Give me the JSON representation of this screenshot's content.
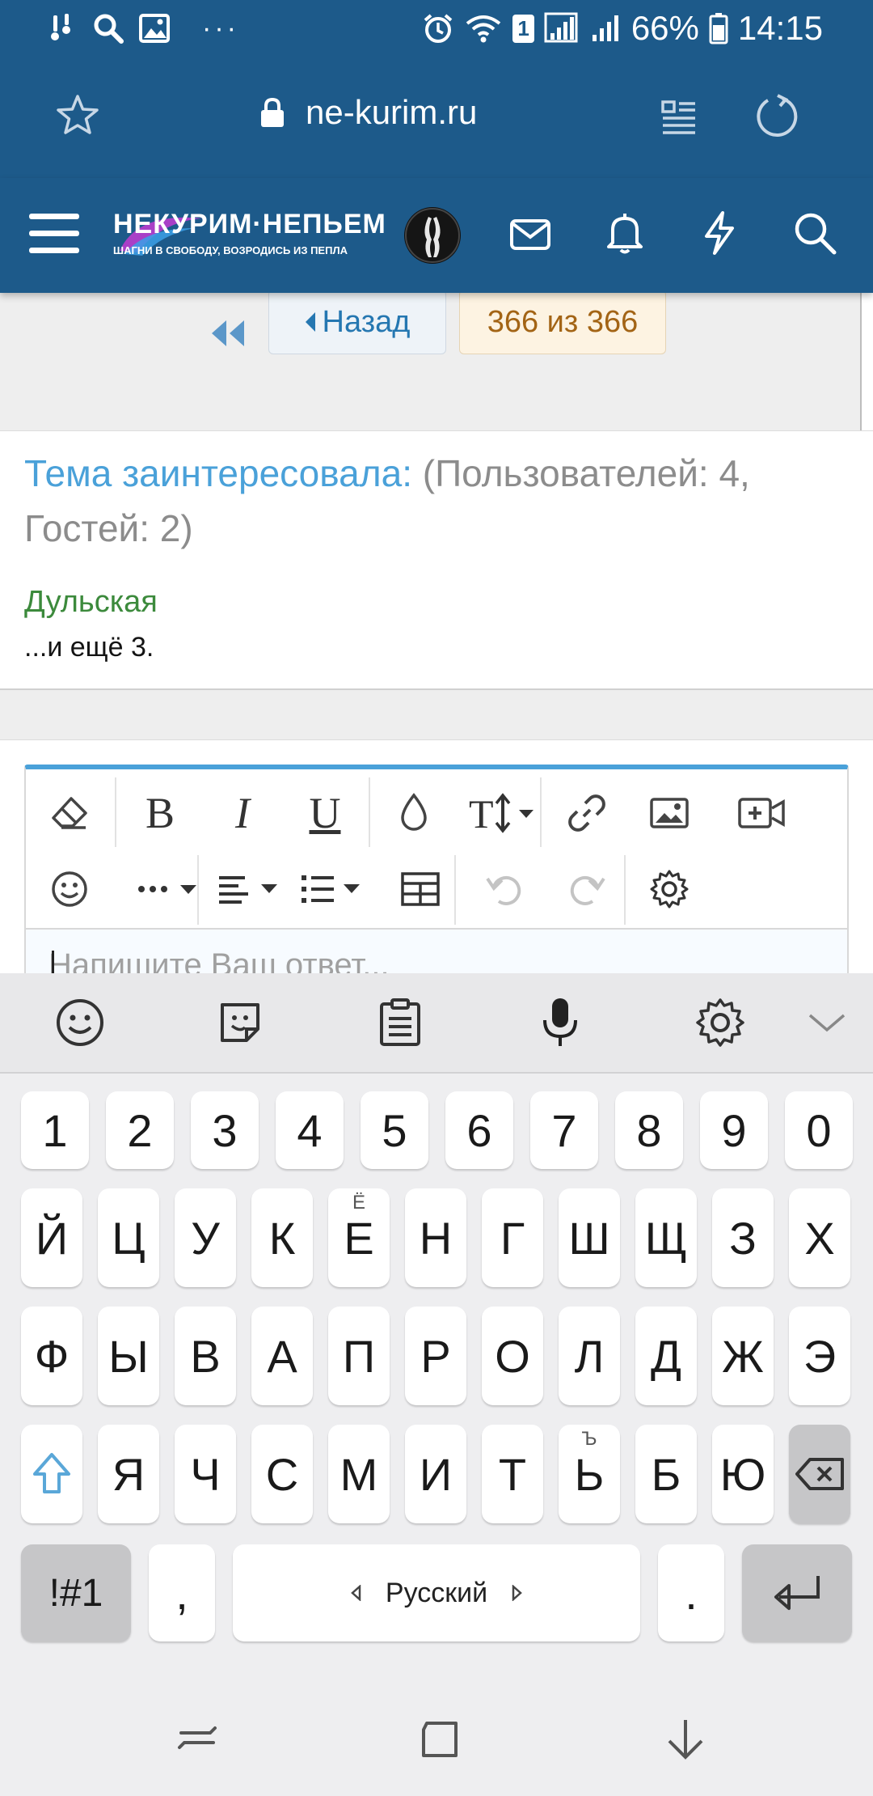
{
  "status_bar": {
    "battery": "66%",
    "time": "14:15",
    "sim_badge": "1",
    "icons": [
      "hand-icon",
      "search-icon",
      "image-icon",
      "more-icon",
      "alarm-icon",
      "wifi-icon",
      "signal-icon",
      "signal2-icon",
      "battery-icon"
    ]
  },
  "browser": {
    "url": "ne-kurim.ru",
    "icons": [
      "star-icon",
      "lock-icon",
      "reader-icon",
      "reload-icon"
    ]
  },
  "site_header": {
    "logo_text": "НЕКУРИМ·НЕПЬЕМ",
    "logo_tagline": "ШАГНИ В СВОБОДУ, ВОЗРОДИСЬ ИЗ ПЕПЛА",
    "icons": [
      "menu-icon",
      "mail-icon",
      "bell-icon",
      "bolt-icon",
      "search-icon"
    ]
  },
  "pager": {
    "back_label": "Назад",
    "count_label": "366 из 366"
  },
  "watchers": {
    "label": "Тема заинтересовала:",
    "counts": "(Пользователей: 4, Гостей: 2)",
    "user": "Дульская",
    "more": "...и ещё 3."
  },
  "editor": {
    "placeholder": "Напишите Ваш ответ...",
    "toolbar_row1": [
      "eraser-icon",
      "bold-icon",
      "italic-icon",
      "underline-icon",
      "color-icon",
      "text-size-icon",
      "link-icon",
      "image-icon",
      "video-icon"
    ],
    "toolbar_row2": [
      "smiley-icon",
      "more-icon",
      "align-icon",
      "list-icon",
      "table-icon",
      "undo-icon",
      "redo-icon",
      "settings-icon"
    ],
    "accent": "#4aa1d9"
  },
  "keyboard": {
    "toolbar": [
      "emoji-icon",
      "sticker-icon",
      "clipboard-icon",
      "mic-icon",
      "settings-icon",
      "collapse-icon"
    ],
    "row_numbers": [
      "1",
      "2",
      "3",
      "4",
      "5",
      "6",
      "7",
      "8",
      "9",
      "0"
    ],
    "row1": [
      "Й",
      "Ц",
      "У",
      "К",
      "Е",
      "Н",
      "Г",
      "Ш",
      "Щ",
      "З",
      "Х"
    ],
    "row1_hint": "Ё",
    "row2": [
      "Ф",
      "Ы",
      "В",
      "А",
      "П",
      "Р",
      "О",
      "Л",
      "Д",
      "Ж",
      "Э"
    ],
    "row3": [
      "Я",
      "Ч",
      "С",
      "М",
      "И",
      "Т",
      "Ь",
      "Б",
      "Ю"
    ],
    "row3_hint": "Ъ",
    "sym_label": "!#1",
    "comma": ",",
    "space_label": "Русский",
    "period": "."
  },
  "colors": {
    "header_blue": "#1d5a8a",
    "link_blue": "#2577b1",
    "user_green": "#3c8a3c",
    "count_orange": "#a36415"
  }
}
